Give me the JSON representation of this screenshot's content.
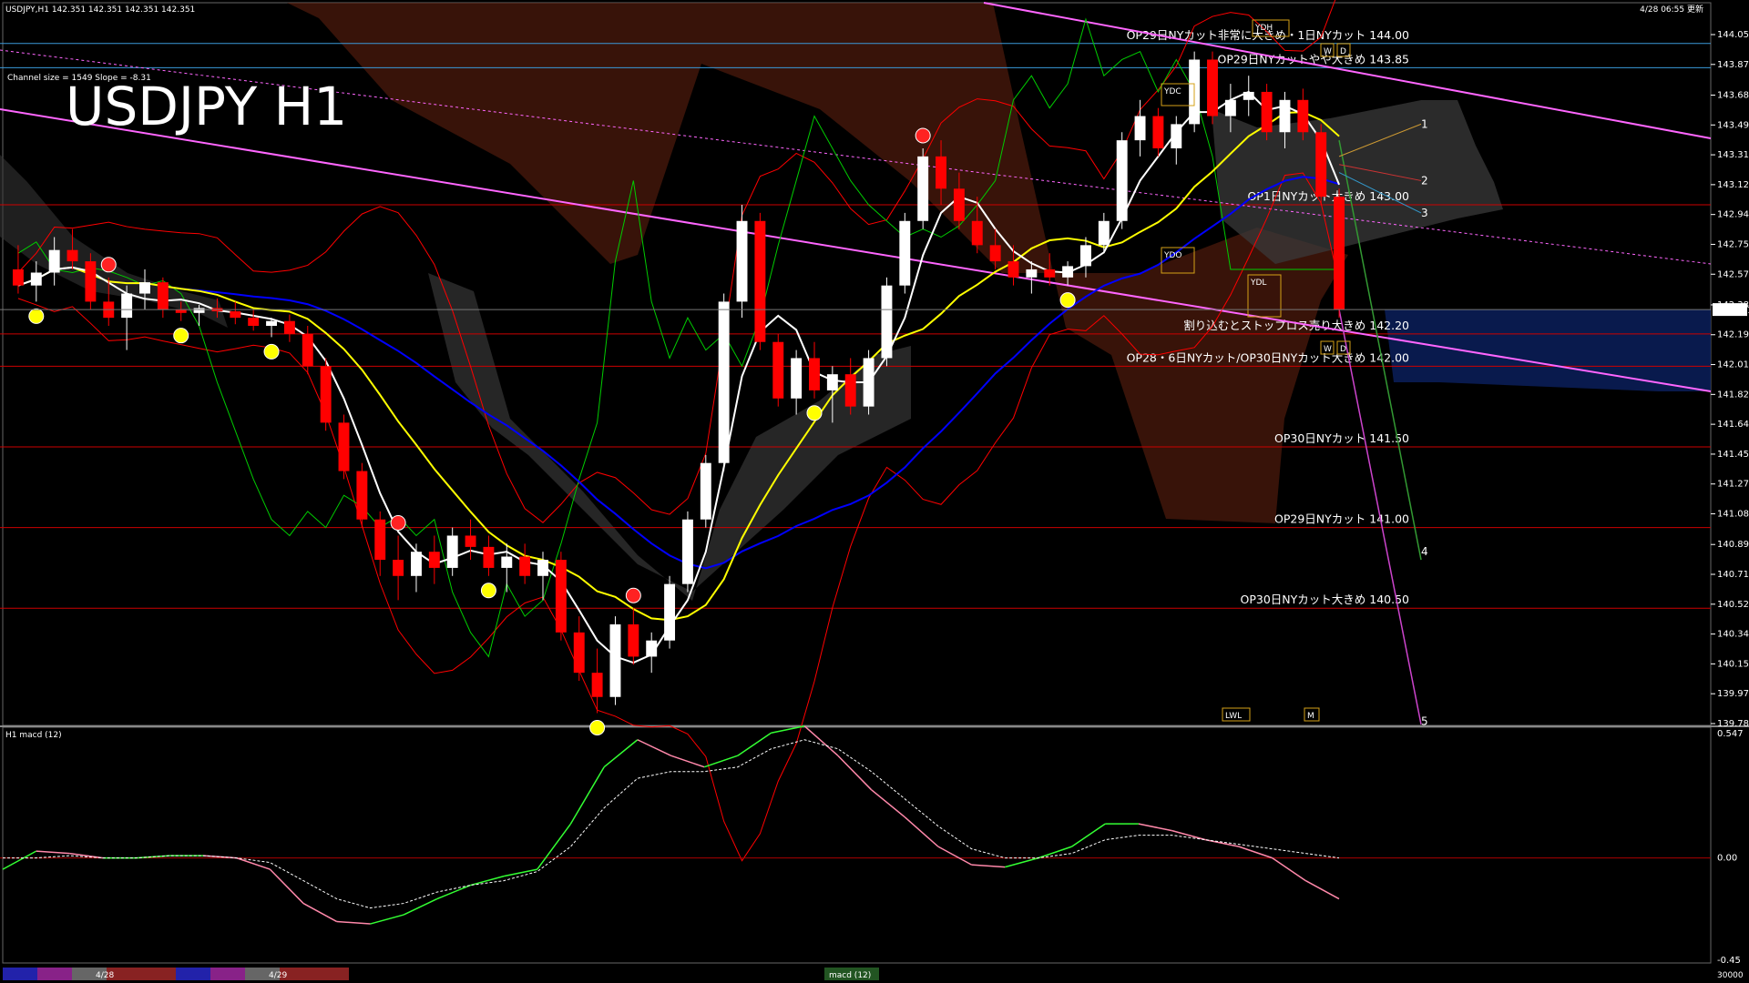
{
  "header": {
    "symbol_info": "USDJPY,H1  142.351 142.351 142.351 142.351",
    "datetime": "4/28 06:55 更新",
    "title": "USDJPY H1",
    "channel_info": "Channel size = 1549 Slope = -8.31"
  },
  "colors": {
    "background": "#000000",
    "bull_candle": "#ffffff",
    "bear_candle": "#ff0000",
    "sma_fast": "#ffffff",
    "sma_mid": "#ffff00",
    "sma_slow": "#0000ff",
    "channel": "#ff66ff",
    "bollinger": "#ff0000",
    "chikou": "#00cc00",
    "cloud_bear": "#ff6633",
    "cloud_bull": "#ffffff",
    "support_line": "#cc0000",
    "macd_line_up": "#33ff33",
    "macd_line_down": "#ff88aa",
    "macd_signal": "#ffffff"
  },
  "price_axis": {
    "ticks": [
      "144.055",
      "143.870",
      "143.680",
      "143.495",
      "143.310",
      "143.125",
      "142.940",
      "142.755",
      "142.570",
      "142.380",
      "142.195",
      "142.010",
      "141.825",
      "141.640",
      "141.455",
      "141.270",
      "141.085",
      "140.895",
      "140.710",
      "140.525",
      "140.340",
      "140.155",
      "139.970",
      "139.785"
    ],
    "current": "142.351"
  },
  "chart_data": [
    {
      "type": "candlestick",
      "title": "USDJPY H1",
      "ylim": [
        139.785,
        144.055
      ],
      "current_price": 142.351,
      "candles": [
        {
          "o": 142.6,
          "h": 142.75,
          "l": 142.45,
          "c": 142.5
        },
        {
          "o": 142.5,
          "h": 142.65,
          "l": 142.4,
          "c": 142.58
        },
        {
          "o": 142.58,
          "h": 142.8,
          "l": 142.5,
          "c": 142.72
        },
        {
          "o": 142.72,
          "h": 142.85,
          "l": 142.6,
          "c": 142.65
        },
        {
          "o": 142.65,
          "h": 142.7,
          "l": 142.35,
          "c": 142.4
        },
        {
          "o": 142.4,
          "h": 142.55,
          "l": 142.25,
          "c": 142.3
        },
        {
          "o": 142.3,
          "h": 142.5,
          "l": 142.1,
          "c": 142.45
        },
        {
          "o": 142.45,
          "h": 142.6,
          "l": 142.35,
          "c": 142.52
        },
        {
          "o": 142.52,
          "h": 142.55,
          "l": 142.3,
          "c": 142.35
        },
        {
          "o": 142.35,
          "h": 142.4,
          "l": 142.28,
          "c": 142.33
        },
        {
          "o": 142.33,
          "h": 142.38,
          "l": 142.25,
          "c": 142.36
        },
        {
          "o": 142.36,
          "h": 142.42,
          "l": 142.3,
          "c": 142.34
        },
        {
          "o": 142.34,
          "h": 142.4,
          "l": 142.26,
          "c": 142.3
        },
        {
          "o": 142.3,
          "h": 142.35,
          "l": 142.22,
          "c": 142.25
        },
        {
          "o": 142.25,
          "h": 142.3,
          "l": 142.18,
          "c": 142.28
        },
        {
          "o": 142.28,
          "h": 142.32,
          "l": 142.15,
          "c": 142.2
        },
        {
          "o": 142.2,
          "h": 142.25,
          "l": 141.95,
          "c": 142.0
        },
        {
          "o": 142.0,
          "h": 142.05,
          "l": 141.6,
          "c": 141.65
        },
        {
          "o": 141.65,
          "h": 141.7,
          "l": 141.3,
          "c": 141.35
        },
        {
          "o": 141.35,
          "h": 141.4,
          "l": 141.0,
          "c": 141.05
        },
        {
          "o": 141.05,
          "h": 141.1,
          "l": 140.7,
          "c": 140.8
        },
        {
          "o": 140.8,
          "h": 140.95,
          "l": 140.55,
          "c": 140.7
        },
        {
          "o": 140.7,
          "h": 140.9,
          "l": 140.6,
          "c": 140.85
        },
        {
          "o": 140.85,
          "h": 140.95,
          "l": 140.65,
          "c": 140.75
        },
        {
          "o": 140.75,
          "h": 141.0,
          "l": 140.7,
          "c": 140.95
        },
        {
          "o": 140.95,
          "h": 141.05,
          "l": 140.8,
          "c": 140.88
        },
        {
          "o": 140.88,
          "h": 140.95,
          "l": 140.7,
          "c": 140.75
        },
        {
          "o": 140.75,
          "h": 140.9,
          "l": 140.6,
          "c": 140.82
        },
        {
          "o": 140.82,
          "h": 140.9,
          "l": 140.65,
          "c": 140.7
        },
        {
          "o": 140.7,
          "h": 140.85,
          "l": 140.55,
          "c": 140.8
        },
        {
          "o": 140.8,
          "h": 140.85,
          "l": 140.3,
          "c": 140.35
        },
        {
          "o": 140.35,
          "h": 140.45,
          "l": 140.05,
          "c": 140.1
        },
        {
          "o": 140.1,
          "h": 140.25,
          "l": 139.85,
          "c": 139.95
        },
        {
          "o": 139.95,
          "h": 140.45,
          "l": 139.9,
          "c": 140.4
        },
        {
          "o": 140.4,
          "h": 140.5,
          "l": 140.15,
          "c": 140.2
        },
        {
          "o": 140.2,
          "h": 140.35,
          "l": 140.1,
          "c": 140.3
        },
        {
          "o": 140.3,
          "h": 140.7,
          "l": 140.25,
          "c": 140.65
        },
        {
          "o": 140.65,
          "h": 141.1,
          "l": 140.6,
          "c": 141.05
        },
        {
          "o": 141.05,
          "h": 141.45,
          "l": 141.0,
          "c": 141.4
        },
        {
          "o": 141.4,
          "h": 142.45,
          "l": 141.35,
          "c": 142.4
        },
        {
          "o": 142.4,
          "h": 143.0,
          "l": 142.3,
          "c": 142.9
        },
        {
          "o": 142.9,
          "h": 142.95,
          "l": 142.1,
          "c": 142.15
        },
        {
          "o": 142.15,
          "h": 142.2,
          "l": 141.75,
          "c": 141.8
        },
        {
          "o": 141.8,
          "h": 142.1,
          "l": 141.7,
          "c": 142.05
        },
        {
          "o": 142.05,
          "h": 142.15,
          "l": 141.8,
          "c": 141.85
        },
        {
          "o": 141.85,
          "h": 142.0,
          "l": 141.65,
          "c": 141.95
        },
        {
          "o": 141.95,
          "h": 142.05,
          "l": 141.7,
          "c": 141.75
        },
        {
          "o": 141.75,
          "h": 142.1,
          "l": 141.7,
          "c": 142.05
        },
        {
          "o": 142.05,
          "h": 142.55,
          "l": 142.0,
          "c": 142.5
        },
        {
          "o": 142.5,
          "h": 142.95,
          "l": 142.45,
          "c": 142.9
        },
        {
          "o": 142.9,
          "h": 143.35,
          "l": 142.85,
          "c": 143.3
        },
        {
          "o": 143.3,
          "h": 143.4,
          "l": 143.0,
          "c": 143.1
        },
        {
          "o": 143.1,
          "h": 143.2,
          "l": 142.85,
          "c": 142.9
        },
        {
          "o": 142.9,
          "h": 143.05,
          "l": 142.7,
          "c": 142.75
        },
        {
          "o": 142.75,
          "h": 142.85,
          "l": 142.6,
          "c": 142.65
        },
        {
          "o": 142.65,
          "h": 142.75,
          "l": 142.5,
          "c": 142.55
        },
        {
          "o": 142.55,
          "h": 142.65,
          "l": 142.45,
          "c": 142.6
        },
        {
          "o": 142.6,
          "h": 142.7,
          "l": 142.5,
          "c": 142.55
        },
        {
          "o": 142.55,
          "h": 142.65,
          "l": 142.5,
          "c": 142.62
        },
        {
          "o": 142.62,
          "h": 142.8,
          "l": 142.55,
          "c": 142.75
        },
        {
          "o": 142.75,
          "h": 142.95,
          "l": 142.7,
          "c": 142.9
        },
        {
          "o": 142.9,
          "h": 143.45,
          "l": 142.85,
          "c": 143.4
        },
        {
          "o": 143.4,
          "h": 143.65,
          "l": 143.3,
          "c": 143.55
        },
        {
          "o": 143.55,
          "h": 143.6,
          "l": 143.3,
          "c": 143.35
        },
        {
          "o": 143.35,
          "h": 143.55,
          "l": 143.25,
          "c": 143.5
        },
        {
          "o": 143.5,
          "h": 143.95,
          "l": 143.45,
          "c": 143.9
        },
        {
          "o": 143.9,
          "h": 143.95,
          "l": 143.5,
          "c": 143.55
        },
        {
          "o": 143.55,
          "h": 143.75,
          "l": 143.45,
          "c": 143.65
        },
        {
          "o": 143.65,
          "h": 143.8,
          "l": 143.55,
          "c": 143.7
        },
        {
          "o": 143.7,
          "h": 143.75,
          "l": 143.4,
          "c": 143.45
        },
        {
          "o": 143.45,
          "h": 143.7,
          "l": 143.35,
          "c": 143.65
        },
        {
          "o": 143.65,
          "h": 143.72,
          "l": 143.4,
          "c": 143.45
        },
        {
          "o": 143.45,
          "h": 143.5,
          "l": 143.0,
          "c": 143.05
        },
        {
          "o": 143.05,
          "h": 143.1,
          "l": 142.3,
          "c": 142.35
        }
      ],
      "horizontal_levels": [
        {
          "price": 144.0,
          "label": "OP29日NYカット非常に大きめ・1日NYカット 144.00"
        },
        {
          "price": 143.85,
          "label": "OP29日NYカットやや大きめ 143.85"
        },
        {
          "price": 143.0,
          "label": "OP1日NYカット大きめ 143.00"
        },
        {
          "price": 142.2,
          "label": "割り込むとストップロス売り大きめ 142.20"
        },
        {
          "price": 142.0,
          "label": "OP28・6日NYカット/OP30日NYカット大きめ 142.00"
        },
        {
          "price": 141.5,
          "label": "OP30日NYカット 141.50"
        },
        {
          "price": 141.0,
          "label": "OP29日NYカット 141.00"
        },
        {
          "price": 140.5,
          "label": "OP30日NYカット大きめ 140.50"
        }
      ],
      "boxes": [
        "YDH",
        "W",
        "D",
        "YDC",
        "YDO",
        "YDL",
        "W",
        "D",
        "LWL",
        "M"
      ],
      "wave_labels": [
        "1",
        "2",
        "3",
        "4",
        "5"
      ],
      "x_labels": [
        "4/28",
        "4/29"
      ]
    },
    {
      "type": "line",
      "title": "H1 macd (12)",
      "ylim": [
        -0.45,
        0.547
      ],
      "axis_ticks": [
        "0.547",
        "0.00",
        "-0.45"
      ],
      "bottom_label": "macd (12)",
      "bottom_value": "30000",
      "series": [
        {
          "values": [
            -0.05,
            0.03,
            0.02,
            0.0,
            0.0,
            0.01,
            0.01,
            0.0,
            -0.05,
            -0.2,
            -0.28,
            -0.29,
            -0.25,
            -0.18,
            -0.12,
            -0.08,
            -0.05,
            0.15,
            0.4,
            0.52,
            0.45,
            0.4,
            0.45,
            0.55,
            0.58,
            0.45,
            0.3,
            0.18,
            0.05,
            -0.03,
            -0.04,
            0.0,
            0.05,
            0.15,
            0.15,
            0.12,
            0.08,
            0.05,
            0.0,
            -0.1,
            -0.18
          ]
        },
        {
          "values": [
            0.0,
            0.0,
            0.01,
            0.0,
            0.0,
            0.01,
            0.01,
            0.0,
            -0.02,
            -0.1,
            -0.18,
            -0.22,
            -0.2,
            -0.15,
            -0.12,
            -0.1,
            -0.06,
            0.05,
            0.22,
            0.35,
            0.38,
            0.38,
            0.4,
            0.48,
            0.52,
            0.48,
            0.38,
            0.26,
            0.14,
            0.04,
            0.0,
            0.0,
            0.02,
            0.08,
            0.1,
            0.1,
            0.08,
            0.06,
            0.04,
            0.02,
            0.0
          ]
        }
      ]
    }
  ]
}
